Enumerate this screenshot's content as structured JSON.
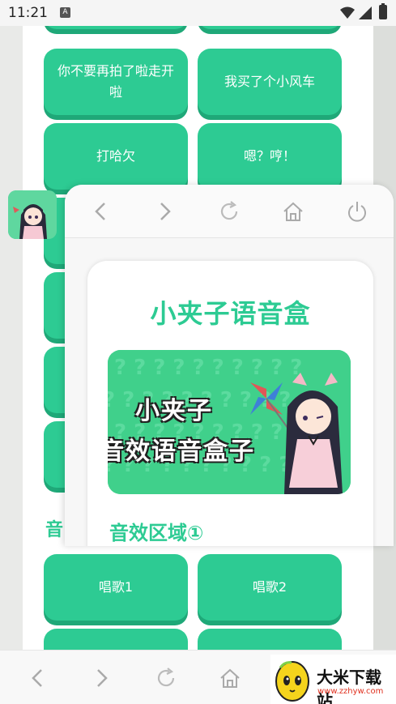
{
  "status_bar": {
    "time": "11:21"
  },
  "background_page": {
    "buttons": [
      {
        "label": "你不要再拍了啦走开啦"
      },
      {
        "label": "我买了个小风车"
      },
      {
        "label": "打哈欠"
      },
      {
        "label": "嗯？哼！"
      }
    ],
    "section_title_partial": "音",
    "bottom_buttons": [
      {
        "label": "唱歌1"
      },
      {
        "label": "唱歌2"
      }
    ]
  },
  "popup": {
    "app_title": "小夹子语音盒",
    "banner": {
      "line1": "小夹子",
      "line2": "音效语音盒子"
    },
    "section_title": "音效区域①"
  },
  "watermark": {
    "name": "大米下载站",
    "url": "www.zzhyw.com"
  },
  "colors": {
    "accent": "#2dcb93",
    "accent_shadow": "#1fa878"
  }
}
